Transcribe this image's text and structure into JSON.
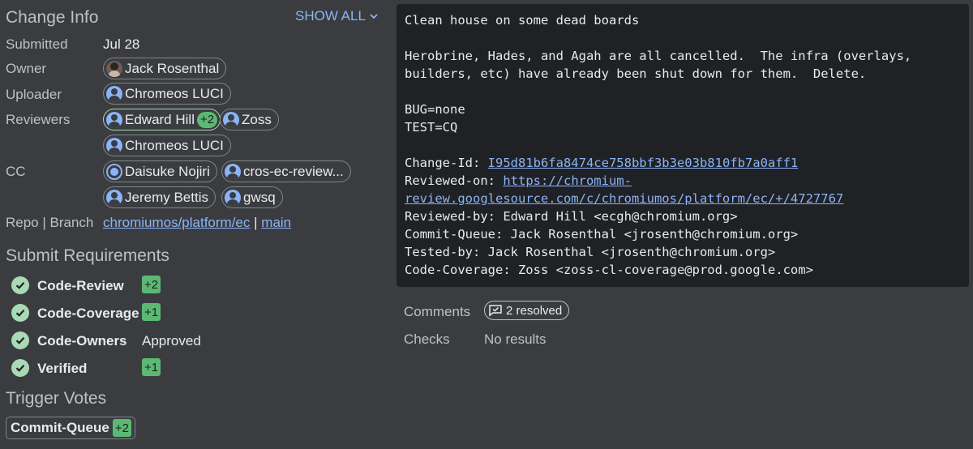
{
  "change_info": {
    "title": "Change Info",
    "show_all": "SHOW ALL",
    "submitted_label": "Submitted",
    "submitted_value": "Jul 28",
    "owner_label": "Owner",
    "owner": "Jack Rosenthal",
    "uploader_label": "Uploader",
    "uploader": "Chromeos LUCI",
    "reviewers_label": "Reviewers",
    "reviewers": [
      {
        "name": "Edward Hill",
        "vote": "+2"
      },
      {
        "name": "Zoss"
      },
      {
        "name": "Chromeos LUCI"
      }
    ],
    "cc_label": "CC",
    "cc": [
      "Daisuke Nojiri",
      "cros-ec-review...",
      "Jeremy Bettis",
      "gwsq"
    ],
    "repo_branch_label": "Repo | Branch",
    "repo": "chromiumos/platform/ec",
    "separator": "|",
    "branch": "main"
  },
  "submit_requirements": {
    "title": "Submit Requirements",
    "items": [
      {
        "name": "Code-Review",
        "value": "+2"
      },
      {
        "name": "Code-Coverage",
        "value": "+1"
      },
      {
        "name": "Code-Owners",
        "value": "Approved"
      },
      {
        "name": "Verified",
        "value": "+1"
      }
    ]
  },
  "trigger_votes": {
    "title": "Trigger Votes",
    "items": [
      {
        "name": "Commit-Queue",
        "value": "+2"
      }
    ]
  },
  "commit_message": {
    "subject": "Clean house on some dead boards",
    "body_line1": "Herobrine, Hades, and Agah are all cancelled.  The infra (overlays,",
    "body_line2": "builders, etc) have already been shut down for them.  Delete.",
    "bug": "BUG=none",
    "test": "TEST=CQ",
    "change_id_label": "Change-Id: ",
    "change_id": "I95d81b6fa8474ce758bbf3b3e03b810fb7a0aff1",
    "reviewed_on_label": "Reviewed-on: ",
    "reviewed_on_1": "https://chromium-",
    "reviewed_on_2": "review.googlesource.com/c/chromiumos/platform/ec/+/4727767",
    "reviewed_by": "Reviewed-by: Edward Hill <ecgh@chromium.org>",
    "commit_queue": "Commit-Queue: Jack Rosenthal <jrosenth@chromium.org>",
    "tested_by": "Tested-by: Jack Rosenthal <jrosenth@chromium.org>",
    "code_coverage": "Code-Coverage: Zoss <zoss-cl-coverage@prod.google.com>"
  },
  "comments": {
    "label": "Comments",
    "resolved": "2 resolved"
  },
  "checks": {
    "label": "Checks",
    "value": "No results"
  },
  "colors": {
    "background": "#3b3c3f",
    "message_bg": "#202124",
    "link": "#8ab4f8",
    "vote_green": "#5bb974",
    "check_green": "#a8dab5"
  },
  "icons": [
    "chevron-down-icon",
    "account-icon",
    "check-circle-icon",
    "comment-resolved-icon"
  ]
}
